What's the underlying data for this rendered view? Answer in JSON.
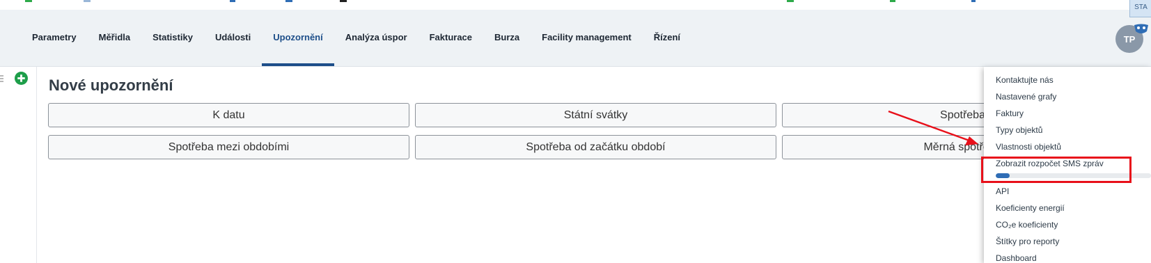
{
  "nav": {
    "items": [
      {
        "label": "Parametry"
      },
      {
        "label": "Měřidla"
      },
      {
        "label": "Statistiky"
      },
      {
        "label": "Události"
      },
      {
        "label": "Upozornění"
      },
      {
        "label": "Analýza úspor"
      },
      {
        "label": "Fakturace"
      },
      {
        "label": "Burza"
      },
      {
        "label": "Facility management"
      },
      {
        "label": "Řízení"
      }
    ],
    "active_index": 4
  },
  "user": {
    "initials": "TP",
    "env_badge": "STA"
  },
  "page": {
    "title": "Nové upozornění"
  },
  "buttons": [
    {
      "label": "K datu"
    },
    {
      "label": "Státní svátky"
    },
    {
      "label": "Spotřeba"
    },
    {
      "label": "Spotřeba mezi obdobími"
    },
    {
      "label": "Spotřeba od začátku období"
    },
    {
      "label": "Měrná spotřeba"
    }
  ],
  "menu": {
    "items": [
      {
        "label": "Kontaktujte nás"
      },
      {
        "label": "Nastavené grafy"
      },
      {
        "label": "Faktury"
      },
      {
        "label": "Typy objektů"
      },
      {
        "label": "Vlastnosti objektů"
      },
      {
        "label": "Zobrazit rozpočet SMS zpráv"
      },
      {
        "label": "API"
      },
      {
        "label": "Koeficienty energií"
      },
      {
        "label": "CO₂e koeficienty"
      },
      {
        "label": "Štítky pro reporty"
      },
      {
        "label": "Dashboard"
      }
    ],
    "sms_budget_progress": 0.09
  },
  "colors": {
    "accent": "#1d4e89",
    "highlight": "#e8101a",
    "add_icon": "#1e9e4a"
  },
  "icons": [
    "add-icon",
    "collapse-icon",
    "mask-icon",
    "annotation-arrow"
  ]
}
